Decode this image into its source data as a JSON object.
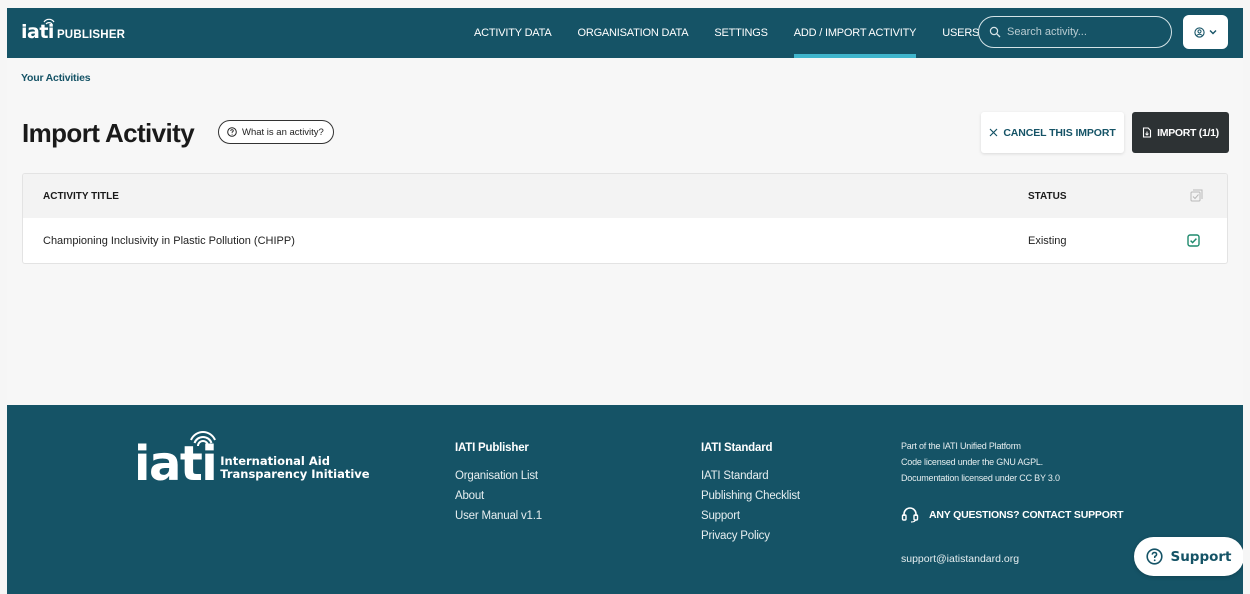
{
  "header": {
    "logo_word": "iati",
    "logo_label": "PUBLISHER",
    "nav": [
      {
        "label": "ACTIVITY DATA",
        "active": false
      },
      {
        "label": "ORGANISATION DATA",
        "active": false
      },
      {
        "label": "SETTINGS",
        "active": false
      },
      {
        "label": "ADD / IMPORT ACTIVITY",
        "active": true
      },
      {
        "label": "USERS",
        "active": false
      }
    ],
    "search_placeholder": "Search activity...",
    "user_icon": "user-circle-icon"
  },
  "breadcrumb": "Your Activities",
  "page": {
    "title": "Import Activity",
    "info_pill": "What is an activity?",
    "cancel_label": "CANCEL THIS IMPORT",
    "import_label": "IMPORT (1/1)"
  },
  "table": {
    "columns": {
      "title": "ACTIVITY TITLE",
      "status": "STATUS"
    },
    "rows": [
      {
        "title": "Championing Inclusivity in Plastic Pollution (CHIPP)",
        "status": "Existing",
        "checked": true
      }
    ]
  },
  "footer": {
    "logo_word": "iati",
    "logo_line1": "International Aid",
    "logo_line2": "Transparency Initiative",
    "col1": {
      "heading": "IATI Publisher",
      "links": [
        "Organisation List",
        "About",
        "User Manual v1.1"
      ]
    },
    "col2": {
      "heading": "IATI Standard",
      "links": [
        "IATI Standard",
        "Publishing Checklist",
        "Support",
        "Privacy Policy"
      ]
    },
    "info": [
      "Part of the IATI Unified Platform",
      "Code licensed under the GNU AGPL.",
      "Documentation licensed under CC BY 3.0"
    ],
    "support_heading": "ANY QUESTIONS? CONTACT SUPPORT",
    "email": "support@iatistandard.org"
  },
  "support_fab": "Support",
  "colors": {
    "brand": "#155366",
    "accent": "#3fb5cc",
    "check": "#1f8a6d",
    "dark_button": "#2d3234"
  }
}
